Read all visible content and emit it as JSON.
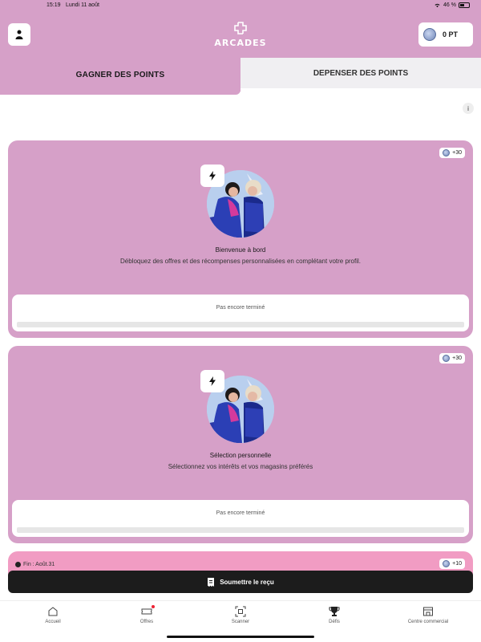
{
  "statusbar": {
    "time": "15:19",
    "date": "Lundi 11 août",
    "battery": "46 %"
  },
  "header": {
    "brand": "ARCADES",
    "points": "0 PT"
  },
  "tabs": {
    "earn": "GAGNER DES POINTS",
    "spend": "DEPENSER DES POINTS"
  },
  "info_label": "i",
  "challenges": [
    {
      "reward": "+30",
      "title": "Bienvenue à bord",
      "description": "Débloquez des offres et des récompenses personnalisées en complétant votre profil.",
      "status": "Pas encore terminé",
      "progress": 0
    },
    {
      "reward": "+30",
      "title": "Sélection personnelle",
      "description": "Sélectionnez vos intérêts et vos magasins préférés",
      "status": "Pas encore terminé",
      "progress": 0
    },
    {
      "reward": "+10",
      "end_date": "Fin : Août.31"
    }
  ],
  "submit_label": "Soumettre le reçu",
  "nav": [
    {
      "label": "Accueil",
      "icon": "home-icon"
    },
    {
      "label": "Offres",
      "icon": "ticket-icon"
    },
    {
      "label": "Scanner",
      "icon": "scan-icon"
    },
    {
      "label": "Défis",
      "icon": "trophy-icon"
    },
    {
      "label": "Centre commercial",
      "icon": "mall-icon"
    }
  ],
  "colors": {
    "brand_pink": "#d6a0c8",
    "card_pink_light": "#f19cc3",
    "dark": "#1c1c1c"
  }
}
